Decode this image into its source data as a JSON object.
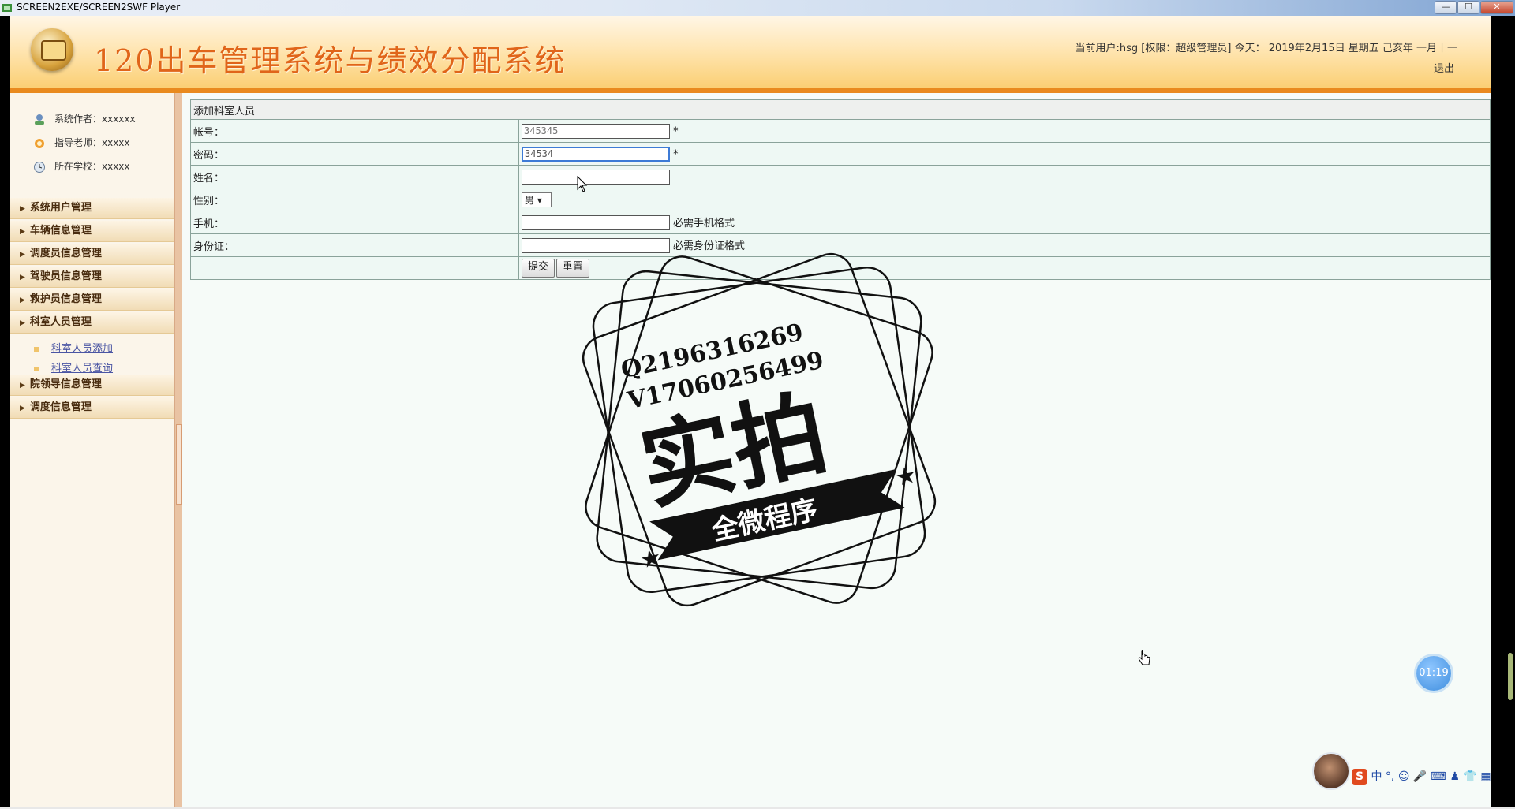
{
  "window": {
    "title": "SCREEN2EXE/SCREEN2SWF Player",
    "min_glyph": "—",
    "max_glyph": "☐",
    "close_glyph": "✕"
  },
  "header": {
    "system_title": "120出车管理系统与绩效分配系统",
    "user_info": "当前用户:hsg [权限：超级管理员] 今天： 2019年2月15日 星期五 己亥年 一月十一",
    "logout": "退出"
  },
  "sidebar": {
    "info": [
      {
        "label": "系统作者：xxxxxx",
        "icon": "user-icon"
      },
      {
        "label": "指导老师：xxxxx",
        "icon": "teacher-icon"
      },
      {
        "label": "所在学校：xxxxx",
        "icon": "school-icon"
      }
    ],
    "arrow": "▶",
    "menu": [
      {
        "label": "系统用户管理"
      },
      {
        "label": "车辆信息管理"
      },
      {
        "label": "调度员信息管理"
      },
      {
        "label": "驾驶员信息管理"
      },
      {
        "label": "救护员信息管理"
      },
      {
        "label": "科室人员管理"
      },
      {
        "label": "院领导信息管理"
      },
      {
        "label": "调度信息管理"
      }
    ],
    "sub_menu": [
      {
        "label": "科室人员添加"
      },
      {
        "label": "科室人员查询"
      }
    ]
  },
  "form": {
    "title": "添加科室人员",
    "account_label": "帐号：",
    "account_value": "345345",
    "password_label": "密码：",
    "password_value": "34534",
    "name_label": "姓名：",
    "name_value": "",
    "gender_label": "性别：",
    "gender_value": "男",
    "phone_label": "手机：",
    "phone_value": "",
    "phone_hint": "必需手机格式",
    "idcard_label": "身份证：",
    "idcard_value": "",
    "idcard_hint": "必需身份证格式",
    "required_mark": "*",
    "submit": "提交",
    "reset": "重置"
  },
  "watermark": {
    "line1": "Q2196316269",
    "line2": "V17060256499",
    "big": "实拍",
    "ribbon": "全微程序"
  },
  "timer": "01:19",
  "ime": {
    "logo": "S",
    "mode": "中"
  },
  "colors": {
    "accent": "#e98a1e",
    "title": "#e0651a",
    "link": "#4a55a3"
  }
}
